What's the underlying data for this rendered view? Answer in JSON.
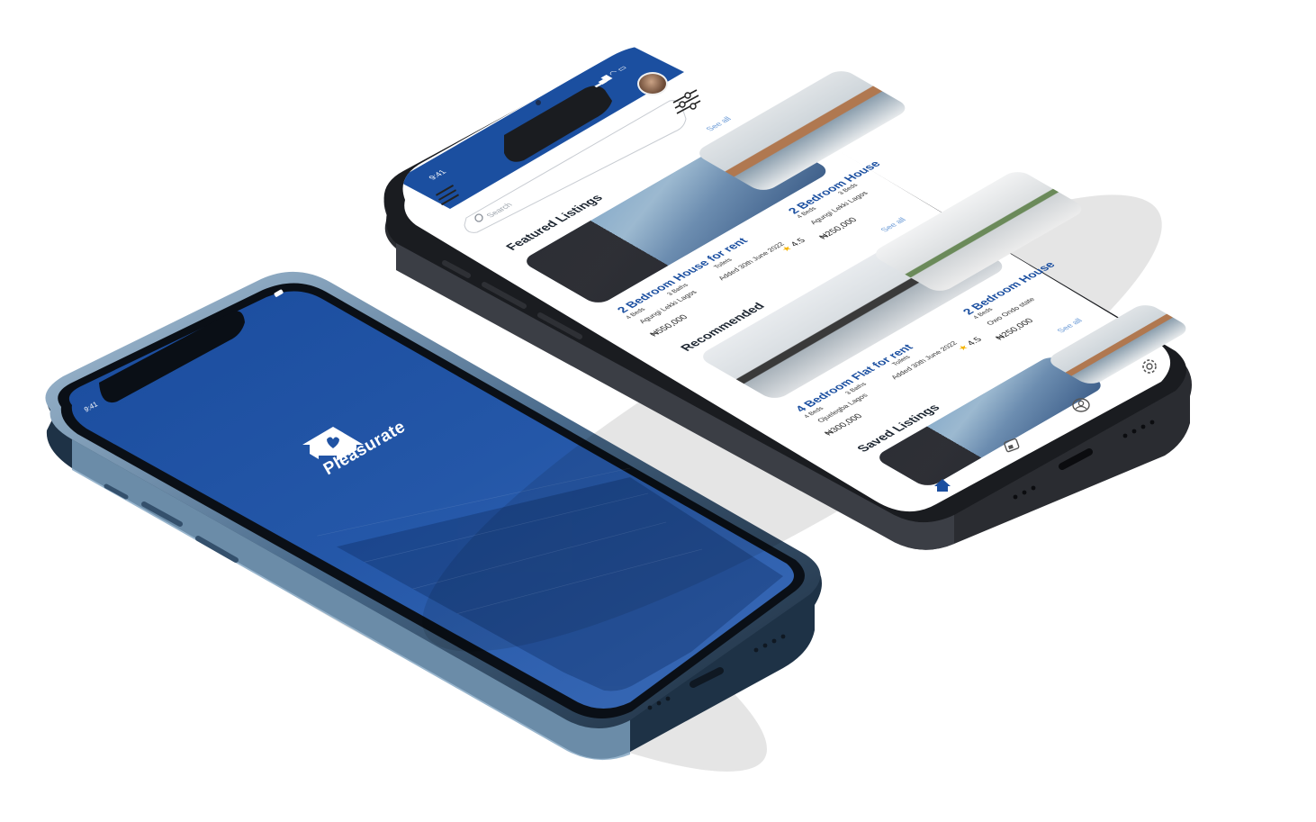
{
  "splash": {
    "time": "9:41",
    "app_name": "Pleasurate",
    "logo_icon": "house-heart-icon",
    "background_color": "#1f52a3"
  },
  "app": {
    "status_bar": {
      "time": "9:41",
      "icons": "signal-icon wifi-icon battery-icon"
    },
    "header": {
      "menu_icon": "hamburger-menu-icon",
      "search_placeholder": "Search",
      "filter_icon": "sliders-filter-icon",
      "avatar_icon": "user-avatar"
    },
    "featured": {
      "title": "Featured Listings",
      "see_all": "See all",
      "cards": [
        {
          "title": "2 Bedroom House for rent",
          "beds": "4 Beds",
          "baths": "3 Baths",
          "toilets": "Toilets",
          "location": "Agungi Lekki Lagos",
          "added": "Added 30th June 2022",
          "price": "₦550,000",
          "rating": "4.5"
        },
        {
          "title": "2 Bedroom House",
          "beds": "4 Beds",
          "baths": "3 Beds",
          "location": "Agungi Lekki Lagos",
          "price": "₦250,000"
        }
      ]
    },
    "recommended": {
      "title": "Recommended",
      "see_all": "See all",
      "cards": [
        {
          "title": "4 Bedroom Flat for rent",
          "beds": "4 Beds",
          "baths": "3 Baths",
          "toilets": "Toilets",
          "location": "Ojuelegba Lagos",
          "added": "Added 30th June 2022",
          "price": "₦300,000",
          "rating": "4.5"
        },
        {
          "title": "2 Bedroom House",
          "beds": "4 Beds",
          "location": "Owo Ondo state",
          "price": "₦250,000"
        }
      ]
    },
    "saved": {
      "title": "Saved Listings",
      "see_all": "See all"
    },
    "bottom_nav": {
      "items": [
        "home-icon",
        "listings-icon",
        "profile-icon",
        "settings-icon"
      ],
      "accent": "#1b4fa0"
    }
  }
}
